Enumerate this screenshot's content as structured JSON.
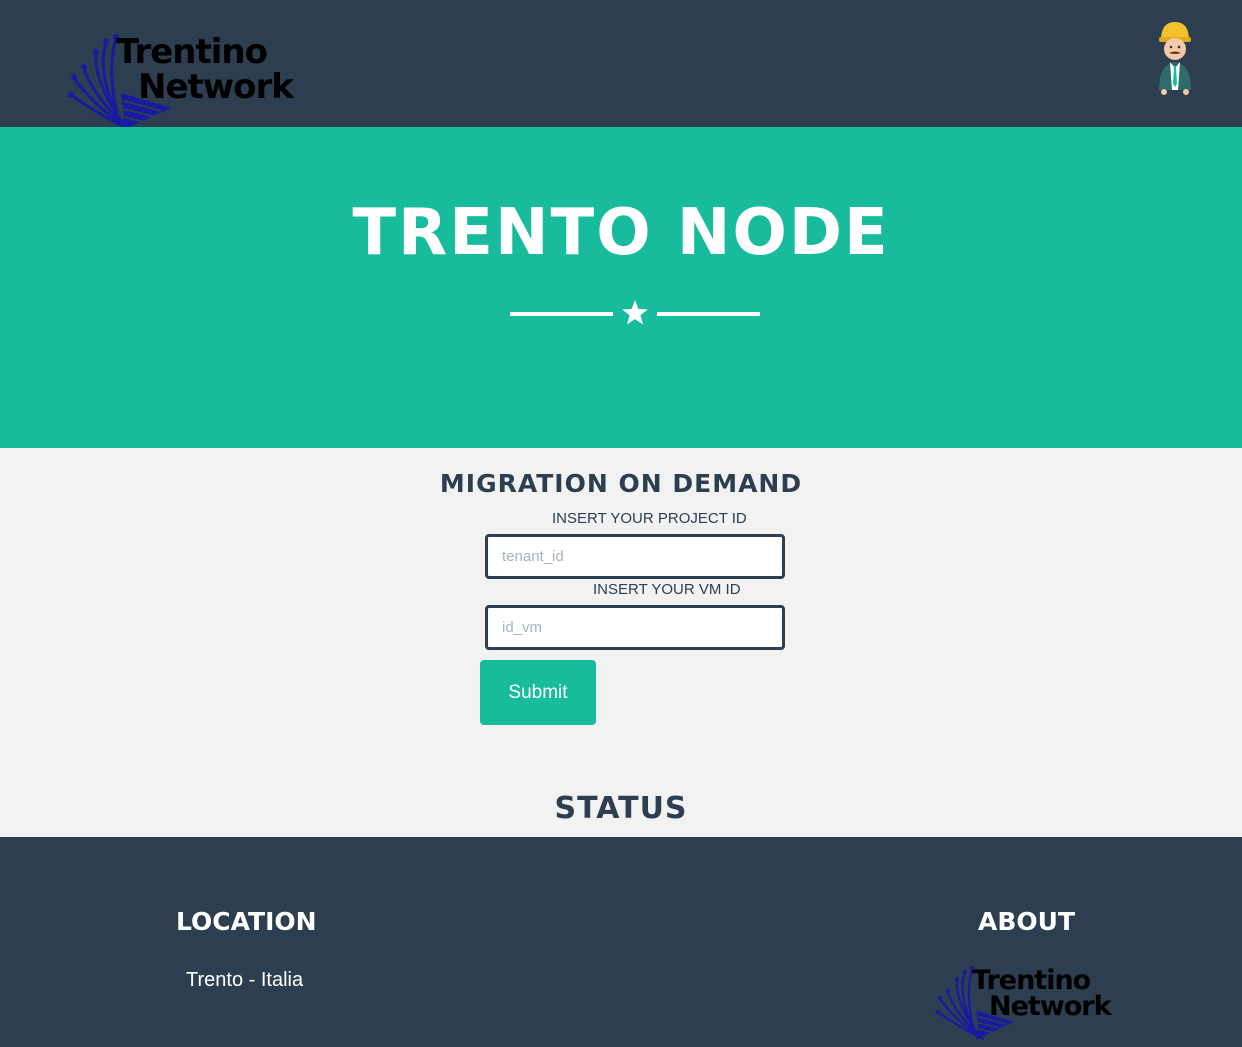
{
  "navbar": {
    "logo": {
      "line1": "Trentino",
      "line2": "Network"
    },
    "avatar_icon": "worker-avatar-icon"
  },
  "hero": {
    "title": "TRENTO NODE",
    "divider_icon": "star-icon"
  },
  "migration": {
    "title": "MIGRATION ON DEMAND",
    "project_label": "INSERT YOUR PROJECT ID",
    "project_placeholder": "tenant_id",
    "project_value": "",
    "vm_label": "INSERT YOUR VM ID",
    "vm_placeholder": "id_vm",
    "vm_value": "",
    "submit_label": "Submit"
  },
  "status": {
    "title": "STATUS"
  },
  "footer": {
    "location_title": "LOCATION",
    "location_text": "Trento - Italia",
    "about_title": "ABOUT",
    "about_logo": {
      "line1": "Trentino",
      "line2": "Network"
    }
  },
  "colors": {
    "navy": "#2c3e50",
    "teal": "#18bc9c",
    "background": "#f2f2f2",
    "logo_blue": "#1a1aa0"
  }
}
